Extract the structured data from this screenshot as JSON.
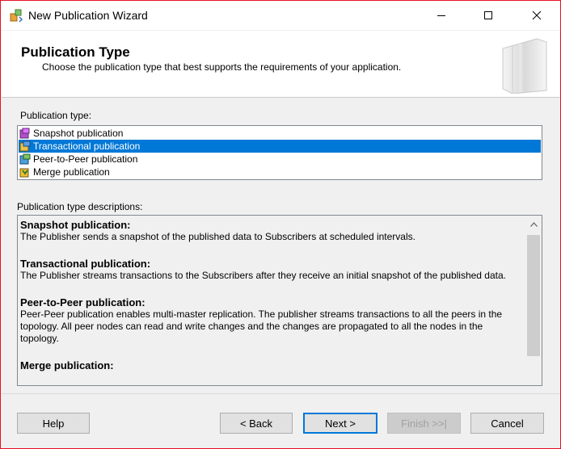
{
  "window": {
    "title": "New Publication Wizard",
    "minimize_icon": "minimize-icon",
    "maximize_icon": "maximize-icon",
    "close_icon": "close-icon"
  },
  "header": {
    "title": "Publication Type",
    "subtitle": "Choose the publication type that best supports the requirements of your application."
  },
  "publication_type": {
    "label": "Publication type:",
    "items": [
      {
        "label": "Snapshot publication",
        "selected": false
      },
      {
        "label": "Transactional publication",
        "selected": true
      },
      {
        "label": "Peer-to-Peer publication",
        "selected": false
      },
      {
        "label": "Merge publication",
        "selected": false
      }
    ]
  },
  "descriptions": {
    "label": "Publication type descriptions:",
    "blocks": [
      {
        "title": "Snapshot publication:",
        "text": "The Publisher sends a snapshot of the published data to Subscribers at scheduled intervals."
      },
      {
        "title": "Transactional publication:",
        "text": "The Publisher streams transactions to the Subscribers after they receive an initial snapshot of the published data."
      },
      {
        "title": "Peer-to-Peer publication:",
        "text": "Peer-Peer publication enables multi-master replication. The publisher streams transactions to all the peers in the topology. All peer nodes can read and write changes and the changes are propagated to all the nodes in the topology."
      },
      {
        "title": "Merge publication:",
        "text": ""
      }
    ]
  },
  "buttons": {
    "help": "Help",
    "back": "< Back",
    "next": "Next >",
    "finish": "Finish >>|",
    "cancel": "Cancel"
  },
  "colors": {
    "selection": "#0078d7",
    "window_border": "#e81123"
  }
}
